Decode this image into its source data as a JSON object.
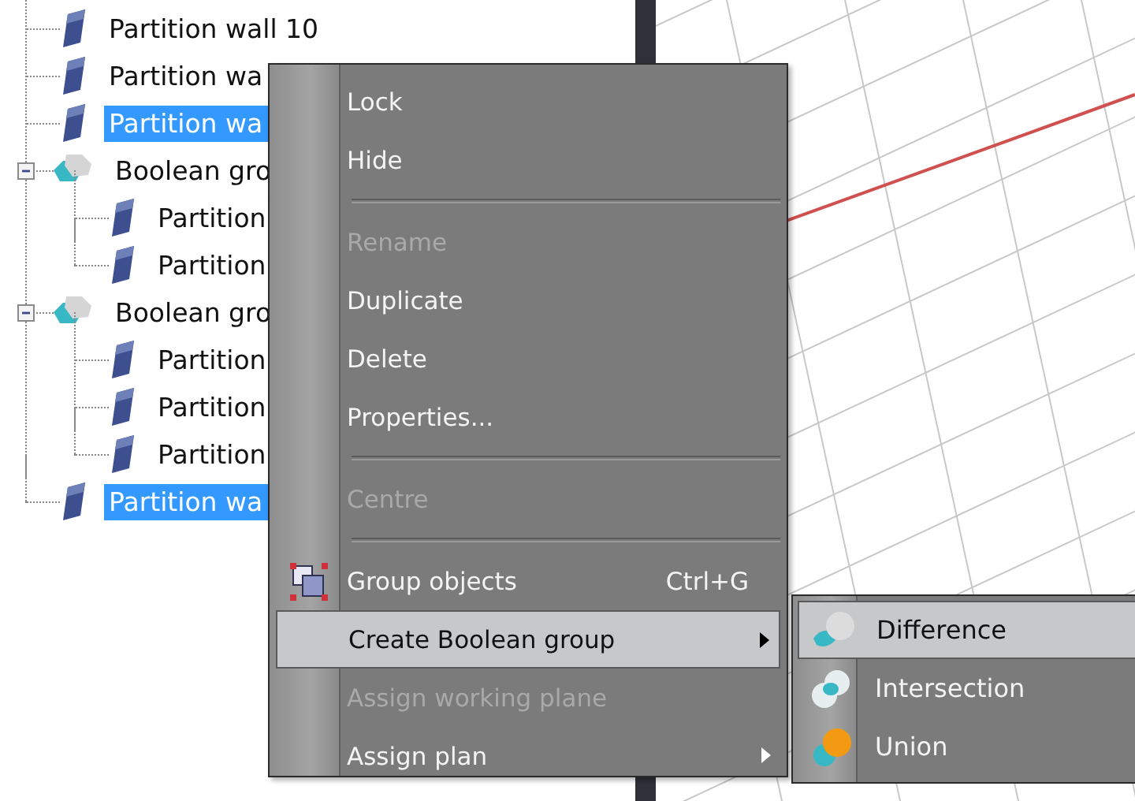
{
  "tree": [
    {
      "kind": "wall",
      "label": "Partition wall 10",
      "selected": false
    },
    {
      "kind": "wall",
      "label": "Partition wa",
      "selected": false
    },
    {
      "kind": "wall",
      "label": "Partition wa",
      "selected": true
    },
    {
      "kind": "boolean",
      "label": "Boolean gro",
      "selected": false,
      "expanded": true,
      "children": [
        {
          "kind": "wall",
          "label": "Partition",
          "selected": false
        },
        {
          "kind": "wall",
          "label": "Partition",
          "selected": false
        }
      ]
    },
    {
      "kind": "boolean",
      "label": "Boolean gro",
      "selected": false,
      "expanded": true,
      "children": [
        {
          "kind": "wall",
          "label": "Partition",
          "selected": false
        },
        {
          "kind": "wall",
          "label": "Partition",
          "selected": false
        },
        {
          "kind": "wall",
          "label": "Partition",
          "selected": false
        }
      ]
    },
    {
      "kind": "wall",
      "label": "Partition wa",
      "selected": true
    }
  ],
  "context_menu": [
    {
      "kind": "item",
      "label": "Lock",
      "disabled": false,
      "selected": false
    },
    {
      "kind": "item",
      "label": "Hide",
      "disabled": false,
      "selected": false
    },
    {
      "kind": "separator"
    },
    {
      "kind": "item",
      "label": "Rename",
      "disabled": true,
      "selected": false
    },
    {
      "kind": "item",
      "label": "Duplicate",
      "disabled": false,
      "selected": false
    },
    {
      "kind": "item",
      "label": "Delete",
      "disabled": false,
      "selected": false
    },
    {
      "kind": "item",
      "label": "Properties...",
      "disabled": false,
      "selected": false
    },
    {
      "kind": "separator"
    },
    {
      "kind": "item",
      "label": "Centre",
      "disabled": true,
      "selected": false
    },
    {
      "kind": "separator"
    },
    {
      "kind": "icon_item",
      "label": "Group objects",
      "disabled": false,
      "selected": false,
      "shortcut": "Ctrl+G"
    },
    {
      "kind": "item",
      "label": "Create Boolean group",
      "disabled": false,
      "selected": true,
      "submenu": true
    },
    {
      "kind": "item",
      "label": "Assign working plane",
      "disabled": true,
      "selected": false
    },
    {
      "kind": "item",
      "label": "Assign plan",
      "disabled": false,
      "selected": false,
      "submenu": true
    }
  ],
  "submenu": [
    {
      "kind": "difference",
      "label": "Difference",
      "selected": true
    },
    {
      "kind": "intersection",
      "label": "Intersection",
      "selected": false
    },
    {
      "kind": "union",
      "label": "Union",
      "selected": false
    }
  ]
}
